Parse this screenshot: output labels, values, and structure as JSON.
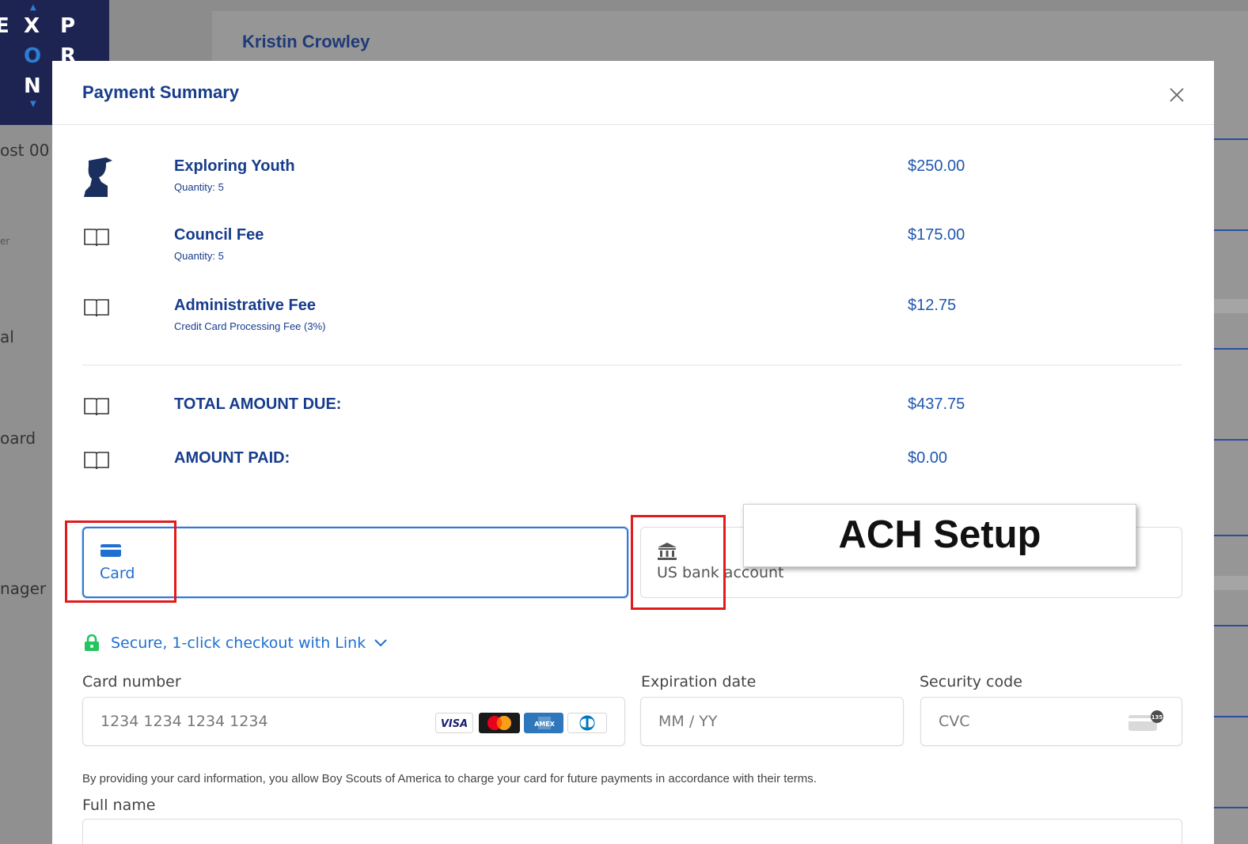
{
  "background": {
    "logo_letters": [
      "E",
      "X",
      "P",
      "O",
      "R",
      "N"
    ],
    "sidebar_fragments": [
      "ost 00",
      "er",
      "al",
      "oard",
      "nager"
    ],
    "user_name": "Kristin Crowley"
  },
  "modal": {
    "title": "Payment Summary",
    "items": [
      {
        "name": "Exploring Youth",
        "sub": "Quantity: 5",
        "price": "$250.00",
        "icon": "person-silhouette-icon"
      },
      {
        "name": "Council Fee",
        "sub": "Quantity: 5",
        "price": "$175.00",
        "icon": "book-icon"
      },
      {
        "name": "Administrative Fee",
        "sub": "Credit Card Processing Fee (3%)",
        "price": "$12.75",
        "icon": "book-icon"
      }
    ],
    "totals": [
      {
        "label": "TOTAL AMOUNT DUE:",
        "value": "$437.75",
        "icon": "book-icon"
      },
      {
        "label": "AMOUNT PAID:",
        "value": "$0.00",
        "icon": "book-icon"
      }
    ]
  },
  "payment": {
    "tabs": [
      {
        "label": "Card",
        "icon": "credit-card-icon",
        "selected": true
      },
      {
        "label": "US bank account",
        "icon": "bank-icon",
        "selected": false
      }
    ],
    "annotation": "ACH Setup",
    "link_text": "Secure, 1-click checkout with Link",
    "card_number": {
      "label": "Card number",
      "placeholder": "1234 1234 1234 1234",
      "brands": [
        "VISA",
        "Mastercard",
        "AMEX",
        "Diners"
      ]
    },
    "expiration": {
      "label": "Expiration date",
      "placeholder": "MM / YY"
    },
    "security": {
      "label": "Security code",
      "placeholder": "CVC",
      "badge": "135"
    },
    "terms": "By providing your card information, you allow Boy Scouts of America to charge your card for future payments in accordance with their terms.",
    "full_name_label": "Full name"
  },
  "colors": {
    "brand_blue": "#173c8c",
    "price_blue": "#1f57b0",
    "link_blue": "#1f6fd1",
    "lock_green": "#22c55e",
    "annotation_red": "#e11b1b"
  }
}
